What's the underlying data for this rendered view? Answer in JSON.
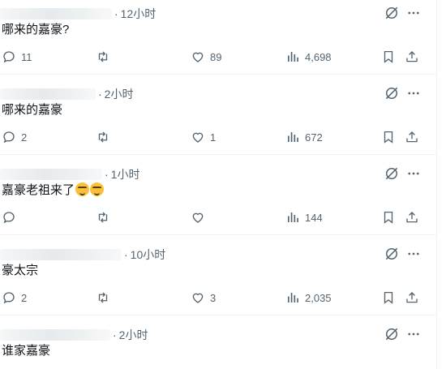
{
  "colors": {
    "text": "#0f1419",
    "muted": "#536471",
    "divider": "#eff3f4"
  },
  "replies": [
    {
      "separator": "·",
      "time": "12小时",
      "text": "哪来的嘉豪?",
      "emoji": [],
      "replies": "11",
      "reposts": "",
      "likes": "89",
      "views": "4,698"
    },
    {
      "separator": "·",
      "time": "2小时",
      "text": "哪来的嘉豪",
      "emoji": [],
      "replies": "2",
      "reposts": "",
      "likes": "1",
      "views": "672"
    },
    {
      "separator": "·",
      "time": "1小时",
      "text": "嘉豪老祖来了",
      "emoji": [
        "nerd-face",
        "nerd-face"
      ],
      "replies": "",
      "reposts": "",
      "likes": "",
      "views": "144"
    },
    {
      "separator": "·",
      "time": "10小时",
      "text": "豪太宗",
      "emoji": [],
      "replies": "2",
      "reposts": "",
      "likes": "3",
      "views": "2,035"
    },
    {
      "separator": "·",
      "time": "2小时",
      "text": "谁家嘉豪",
      "emoji": [],
      "replies": "",
      "reposts": "",
      "likes": "",
      "views": ""
    }
  ]
}
